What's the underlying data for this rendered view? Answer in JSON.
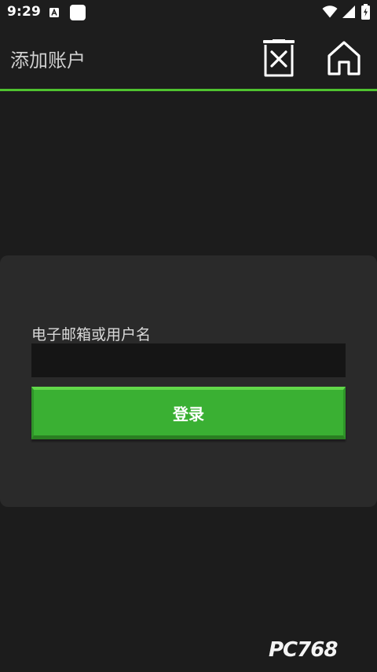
{
  "status_bar": {
    "time": "9:29",
    "icons": [
      "app-a-icon",
      "app-square-icon",
      "wifi-icon",
      "signal-icon",
      "battery-charging-icon"
    ]
  },
  "app_bar": {
    "title": "添加账户",
    "actions": [
      {
        "name": "delete-button",
        "icon": "delete-icon"
      },
      {
        "name": "home-button",
        "icon": "home-icon"
      }
    ],
    "accent_color": "#4fc32f"
  },
  "login_form": {
    "field_label": "电子邮箱或用户名",
    "username_value": "",
    "login_button_label": "登录",
    "button_color": "#3ab033"
  },
  "watermark": {
    "text": "PC768"
  }
}
